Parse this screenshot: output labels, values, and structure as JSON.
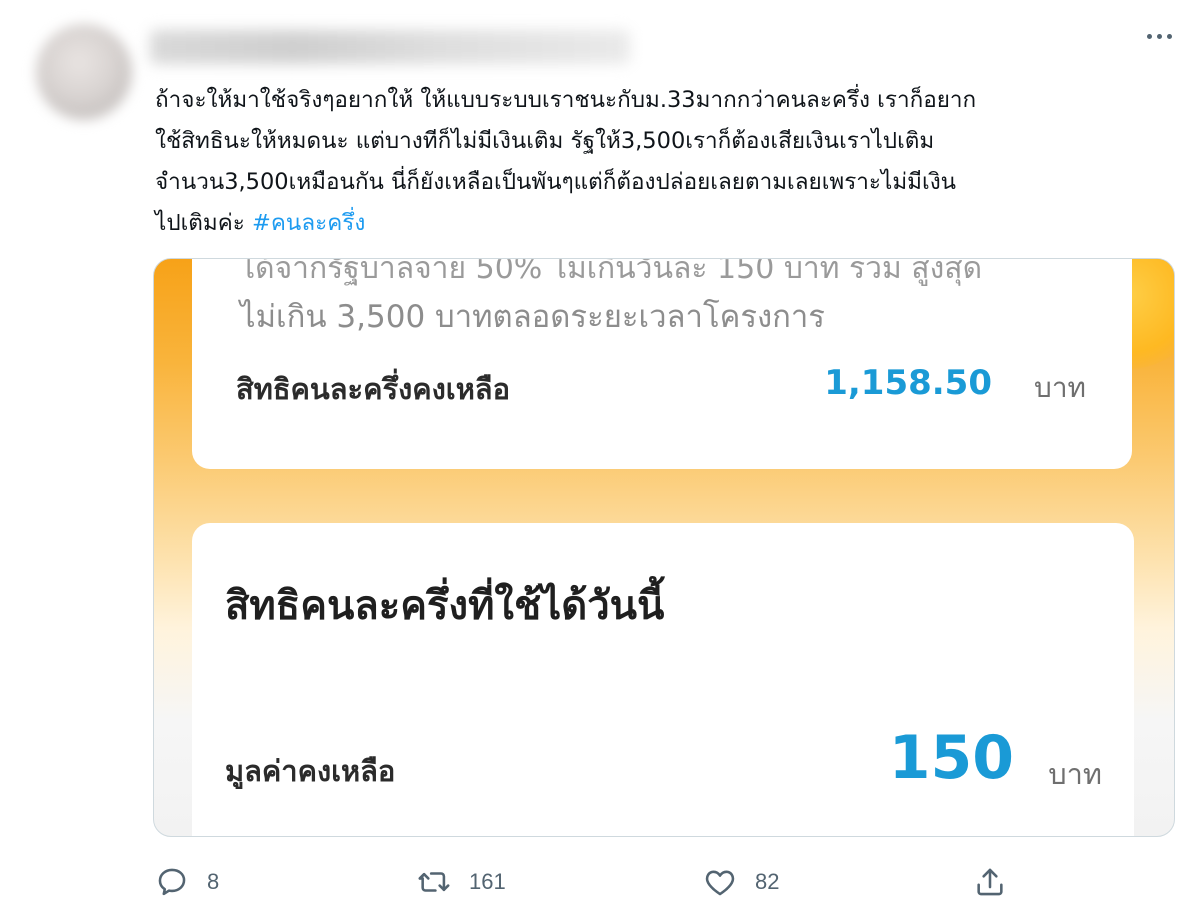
{
  "tweet": {
    "text_lines": [
      "ถ้าจะให้มาใช้จริงๆอยากให้ ให้แบบระบบเราชนะกับม.33มากกว่าคนละครึ่ง เราก็อยาก",
      "ใช้สิทธินะให้หมดนะ แต่บางทีก็ไม่มีเงินเติม รัฐให้3,500เราก็ต้องเสียเงินเราไปเติม",
      "จำนวน3,500เหมือนกัน นี่ก็ยังเหลือเป็นพันๆแต่ก็ต้องปล่อยเลยตามเลยเพราะไม่มีเงิน",
      "ไปเติมค่ะ"
    ],
    "hashtag": "#คนละครึ่ง"
  },
  "media": {
    "card1": {
      "cut_text": "ได้จากรัฐบาลจ่าย 50% ไม่เกินวันละ 150 บาท รวม สูงสุด",
      "desc": "ไม่เกิน 3,500 บาทตลอดระยะเวลาโครงการ",
      "label": "สิทธิคนละครึ่งคงเหลือ",
      "amount": "1,158.50",
      "unit": "บาท"
    },
    "card2": {
      "title": "สิทธิคนละครึ่งที่ใช้ได้วันนี้",
      "label": "มูลค่าคงเหลือ",
      "amount": "150",
      "unit": "บาท"
    }
  },
  "actions": {
    "reply_count": "8",
    "retweet_count": "161",
    "like_count": "82",
    "icons": [
      "reply-icon",
      "retweet-icon",
      "like-icon",
      "share-icon"
    ]
  },
  "colors": {
    "link": "#1d9bf0",
    "amount": "#1a9ad6",
    "icon": "#536471"
  }
}
